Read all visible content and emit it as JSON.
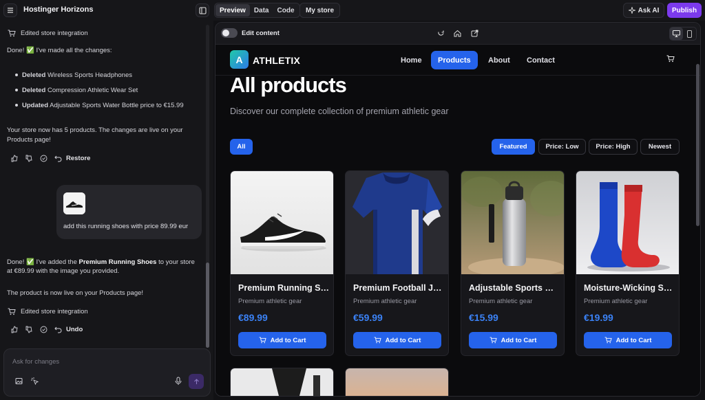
{
  "app": {
    "title": "Hostinger Horizons",
    "tabs": [
      {
        "label": "Preview",
        "active": true
      },
      {
        "label": "Data",
        "active": false
      },
      {
        "label": "Code",
        "active": false
      }
    ],
    "my_store": "My store",
    "ask_ai": "Ask AI",
    "publish": "Publish",
    "accent": "#7c3aed"
  },
  "chat": {
    "msg1": {
      "meta": "Edited store integration",
      "intro": "Done! ✅ I've made all the changes:",
      "bullets": [
        {
          "bold": "Deleted",
          "text": " Wireless Sports Headphones"
        },
        {
          "bold": "Deleted",
          "text": " Compression Athletic Wear Set"
        },
        {
          "bold": "Updated",
          "text": " Adjustable Sports Water Bottle price to €15.99"
        }
      ],
      "summary1": "Your store now has 5 products. The changes are live on your",
      "summary2": "Products page!",
      "action_label": "Restore"
    },
    "user_msg": "add this running shoes with price 89.99 eur",
    "msg2": {
      "line1_pre": "Done! ✅ I've added the ",
      "line1_bold": "Premium Running Shoes",
      "line1_post": " to your store",
      "line2": "at €89.99 with the image you provided.",
      "line3": "The product is now live on your Products page!",
      "meta": "Edited store integration",
      "action_label": "Undo"
    },
    "input_placeholder": "Ask for changes"
  },
  "preview": {
    "edit_content": "Edit content",
    "site": {
      "logo_letter": "A",
      "brand": "ATHLETIX",
      "nav": [
        {
          "label": "Home",
          "active": false
        },
        {
          "label": "Products",
          "active": true
        },
        {
          "label": "About",
          "active": false
        },
        {
          "label": "Contact",
          "active": false
        }
      ],
      "title": "All products",
      "subtitle": "Discover our complete collection of premium athletic gear",
      "filter_all": "All",
      "sorts": [
        {
          "label": "Featured",
          "active": true
        },
        {
          "label": "Price: Low",
          "active": false
        },
        {
          "label": "Price: High",
          "active": false
        },
        {
          "label": "Newest",
          "active": false
        }
      ],
      "products": [
        {
          "name": "Premium Running Shoes",
          "desc": "Premium athletic gear",
          "price": "€89.99",
          "button": "Add to Cart",
          "image": "running-shoe"
        },
        {
          "name": "Premium Football Jersey",
          "desc": "Premium athletic gear",
          "price": "€59.99",
          "button": "Add to Cart",
          "image": "football-jersey"
        },
        {
          "name": "Adjustable Sports Water Bottle",
          "desc": "Premium athletic gear",
          "price": "€15.99",
          "button": "Add to Cart",
          "image": "water-bottle"
        },
        {
          "name": "Moisture-Wicking Socks",
          "desc": "Premium athletic gear",
          "price": "€19.99",
          "button": "Add to Cart",
          "image": "sport-socks"
        }
      ],
      "accent": "#2563eb"
    }
  }
}
